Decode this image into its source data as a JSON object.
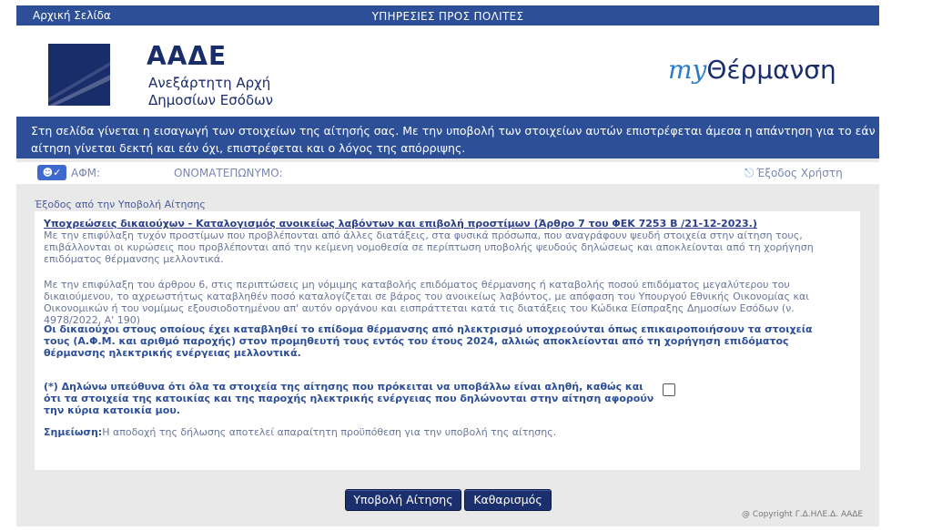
{
  "topbar": {
    "home_label": "Αρχική Σελίδα",
    "title": "ΥΠΗΡΕΣΙΕΣ ΠΡΟΣ ΠΟΛΙΤΕΣ"
  },
  "header": {
    "org_acronym": "ΑΑΔΕ",
    "org_name_line1": "Ανεξάρτητη Αρχή",
    "org_name_line2": "Δημοσίων Εσόδων",
    "app_brand_my": "my",
    "app_brand_name": "Θέρμανση"
  },
  "info": {
    "line1": "Στη σελίδα γίνεται η εισαγωγή των στοιχείων της αίτησής σας. Με την υποβολή των στοιχείων αυτών επιστρέφεται άμεσα η απάντηση για το εάν η",
    "line2": "αίτηση γίνεται δεκτή και εάν όχι, επιστρέφεται και ο λόγος της απόρριψης."
  },
  "user": {
    "afm_label": "ΑΦΜ:",
    "name_label": "ΟΝΟΜΑΤΕΠΩΝΥΜΟ:",
    "logout_label": "Έξοδος Χρήστη"
  },
  "exit_link": "Έξοδος από την Υποβολή Αίτησης",
  "content": {
    "title": "Υποχρεώσεις δικαιούχων - Καταλογισμός ανοικείως λαβόντων και επιβολή προστίμων (Άρθρο 7 του ΦΕΚ 7253 Β /21-12-2023.)",
    "para1": "Με την επιφύλαξη τυχόν προστίμων που προβλέπονται από άλλες διατάξεις, στα φυσικά πρόσωπα, που αναγράφουν ψευδή στοιχεία στην αίτηση τους, επιβάλλονται οι κυρώσεις που προβλέπονται από την κείμενη νομοθεσία σε περίπτωση υποβολής ψευδούς δηλώσεως και αποκλείονται από τη χορήγηση επιδόματος θέρμανσης μελλοντικά.",
    "para2": "Με την επιφύλαξη του άρθρου 6, στις περιπτώσεις μη νόμιμης καταβολής επιδόματος θέρμανσης ή καταβολής ποσού επιδόματος μεγαλύτερου του δικαιούμενου, το αχρεωστήτως καταβληθέν ποσό καταλογίζεται σε βάρος του ανοικείως λαβόντος, με απόφαση του Υπουργού Εθνικής Οικονομίας και Οικονομικών ή του νομίμως εξουσιοδοτημένου απ' αυτόν οργάνου και εισπράττεται κατά τις διατάξεις του Κώδικα Είσπραξης Δημοσίων Εσόδων (ν. 4978/2022, Α' 190)",
    "para_bold": "Οι δικαιούχοι στους οποίους έχει καταβληθεί το επίδομα θέρμανσης από ηλεκτρισμό υποχρεούνται όπως επικαιροποιήσουν τα στοιχεία τους (Α.Φ.Μ. και αριθμό παροχής) στον προμηθευτή τους εντός του έτους 2024, αλλιώς αποκλείονται από τη χορήγηση επιδόματος θέρμανσης ηλεκτρικής ενέργειας μελλοντικά.",
    "declaration": "(*) Δηλώνω υπεύθυνα ότι όλα τα στοιχεία της αίτησης που πρόκειται να υποβάλλω είναι αληθή, καθώς και ότι τα στοιχεία της κατοικίας και της παροχής ηλεκτρικής ενέργειας που δηλώνονται στην αίτηση αφορούν την κύρια κατοικία μου.",
    "note_label": "Σημείωση:",
    "note_text": "Η αποδοχή της δήλωσης αποτελεί απαραίτητη προϋπόθεση για την υποβολή της αίτησης."
  },
  "buttons": {
    "submit": "Υποβολή Αίτησης",
    "clear": "Καθαρισμός"
  },
  "footer": {
    "copyright": "@ Copyright Γ.Δ.ΗΛΕ.Δ. ΑΑΔΕ"
  }
}
